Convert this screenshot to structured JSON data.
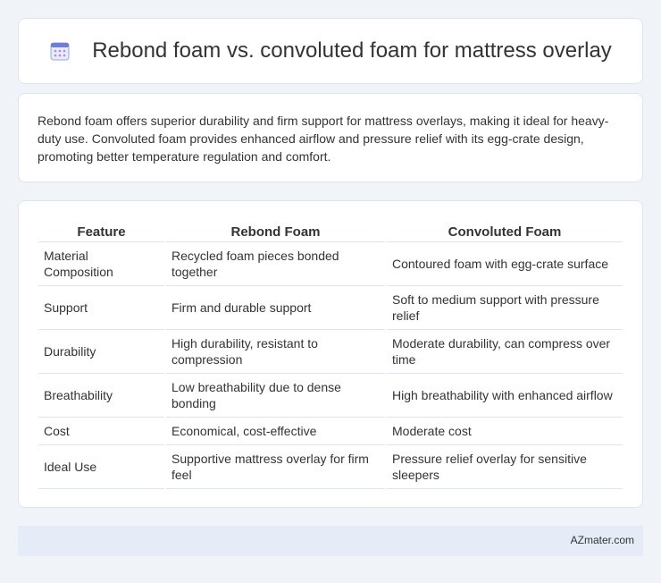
{
  "header": {
    "title": "Rebond foam vs. convoluted foam for mattress overlay",
    "icon": "calendar-icon",
    "icon_color": "#6b7fd7"
  },
  "intro": {
    "text": "Rebond foam offers superior durability and firm support for mattress overlays, making it ideal for heavy-duty use. Convoluted foam provides enhanced airflow and pressure relief with its egg-crate design, promoting better temperature regulation and comfort."
  },
  "table": {
    "headers": [
      "Feature",
      "Rebond Foam",
      "Convoluted Foam"
    ],
    "rows": [
      [
        "Material Composition",
        "Recycled foam pieces bonded together",
        "Contoured foam with egg-crate surface"
      ],
      [
        "Support",
        "Firm and durable support",
        "Soft to medium support with pressure relief"
      ],
      [
        "Durability",
        "High durability, resistant to compression",
        "Moderate durability, can compress over time"
      ],
      [
        "Breathability",
        "Low breathability due to dense bonding",
        "High breathability with enhanced airflow"
      ],
      [
        "Cost",
        "Economical, cost-effective",
        "Moderate cost"
      ],
      [
        "Ideal Use",
        "Supportive mattress overlay for firm feel",
        "Pressure relief overlay for sensitive sleepers"
      ]
    ]
  },
  "footer": {
    "text": "AZmater.com",
    "background": "#e6ecf7"
  }
}
